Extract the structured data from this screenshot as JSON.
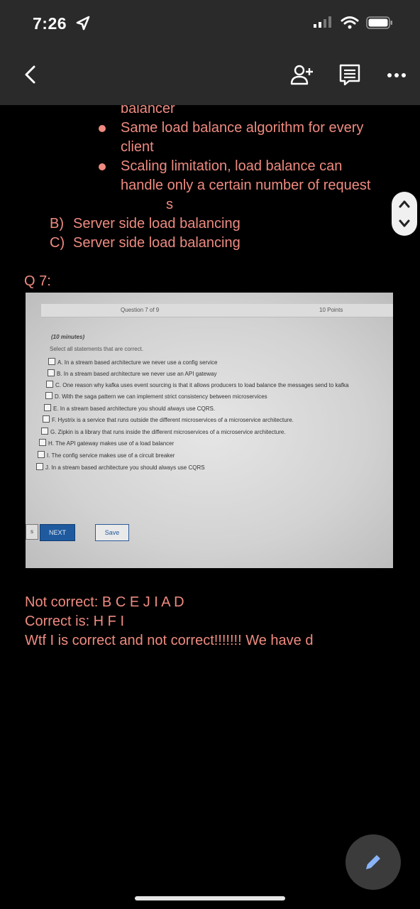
{
  "status_bar": {
    "time": "7:26"
  },
  "toolbar": {
    "back_icon": "chevron-left-icon",
    "add_person_icon": "person-add-icon",
    "notes_icon": "comment-icon",
    "more_icon": "more-horizontal-icon"
  },
  "slide_text": {
    "cut_line": "balancer",
    "bullets": [
      [
        "Same load balance algorithm for every",
        "client"
      ],
      [
        "Scaling limitation, load balance can",
        "handle only a certain number of request",
        "s"
      ]
    ],
    "options": [
      {
        "letter": "B)",
        "text": "Server side load balancing"
      },
      {
        "letter": "C)",
        "text": "Server side load balancing"
      }
    ],
    "question_label": "Q 7:"
  },
  "photo": {
    "header_left": "Question 7 of 9",
    "header_right": "10 Points",
    "time_note": "(10 minutes)",
    "instruction": "Select all statements that are correct.",
    "options": [
      "A. In a stream based architecture we never use a config service",
      "B. In a stream based architecture we never use an API gateway",
      "C. One reason why kafka uses event sourcing is that it allows producers to load balance the messages send to kafka",
      "D. With the saga pattern we can implement strict consistency between microservices",
      "E. In a stream based architecture you should always use CQRS.",
      "F. Hystrix is a service that runs outside the different microservices of a microservice architecture.",
      "G. Zipkin is a library that runs inside the different microservices of a microservice architecture.",
      "H. The API gateway makes use of a load balancer",
      "I. The config service makes use of a circuit breaker",
      "J. In a stream based architecture you should always use CQRS"
    ],
    "prev_label": "s",
    "next_label": "NEXT",
    "save_label": "Save"
  },
  "notes": {
    "line1": "Not correct:  B C E J  I  A D",
    "line2": "Correct is: H F I",
    "line3": "Wtf I is correct and not correct!!!!!!!  We have d"
  },
  "colors": {
    "text_accent": "#ef8b80",
    "toolbar_bg": "#2a2a2a",
    "fab_icon": "#8ab4f8"
  }
}
